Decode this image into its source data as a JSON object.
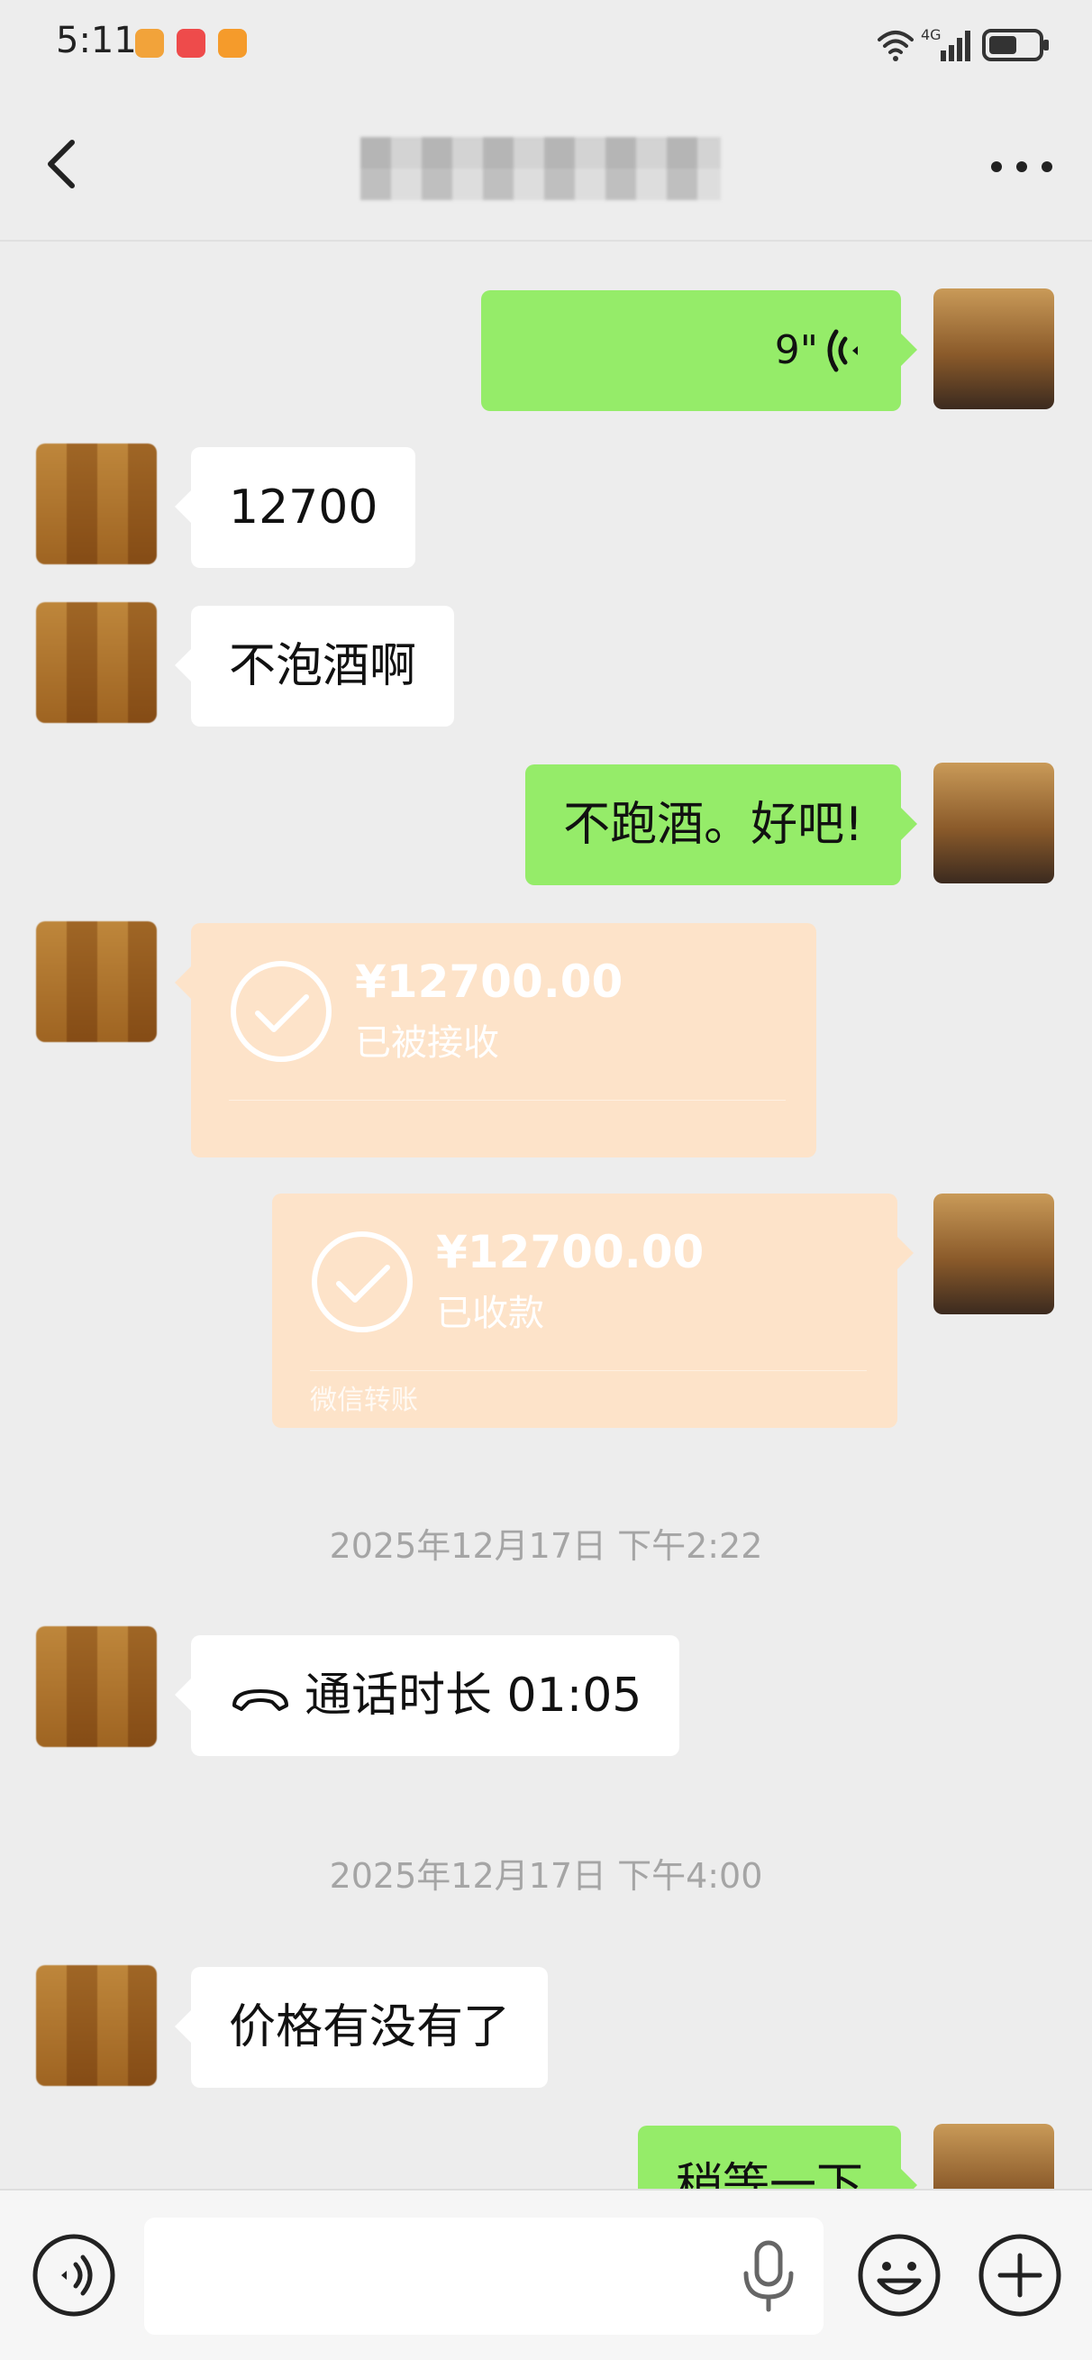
{
  "status_bar": {
    "time": "5:11",
    "network": "4G",
    "icons": [
      "wifi-icon",
      "signal-icon",
      "battery-icon"
    ]
  },
  "nav": {
    "title": "",
    "back_icon": "chevron-left-icon",
    "more_icon": "more-dots-icon"
  },
  "messages": {
    "m1": {
      "type": "voice",
      "sender": "self",
      "duration": "9\""
    },
    "m2": {
      "type": "text",
      "sender": "other",
      "text": "12700"
    },
    "m3": {
      "type": "text",
      "sender": "other",
      "text": "不泡酒啊"
    },
    "m4": {
      "type": "text",
      "sender": "self",
      "text": "不跑酒。好吧!"
    },
    "m5": {
      "type": "transfer",
      "sender": "other",
      "amount": "¥12700.00",
      "status": "已被接收"
    },
    "m6": {
      "type": "transfer",
      "sender": "self",
      "amount": "¥12700.00",
      "status": "已收款",
      "footer": "微信转账"
    },
    "t1": {
      "type": "timestamp",
      "text": "2025年12月17日 下午2:22"
    },
    "m7": {
      "type": "call",
      "sender": "other",
      "text": "通话时长 01:05"
    },
    "t2": {
      "type": "timestamp",
      "text": "2025年12月17日 下午4:00"
    },
    "m8": {
      "type": "text",
      "sender": "other",
      "text": "价格有没有了"
    },
    "m9": {
      "type": "text",
      "sender": "self",
      "text": "稍等一下"
    }
  },
  "colors": {
    "background": "#ededed",
    "self_bubble": "#95ec69",
    "other_bubble": "#ffffff",
    "transfer": "#fde3c9",
    "timestamp": "#a5a5a5"
  },
  "input_bar": {
    "placeholder": "",
    "icons": [
      "voice-toggle-icon",
      "mic-icon",
      "emoji-icon",
      "plus-icon"
    ]
  }
}
